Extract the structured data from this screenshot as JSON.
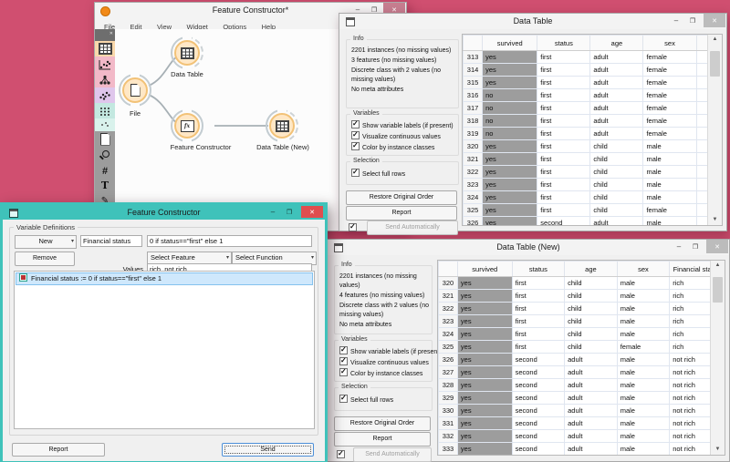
{
  "colors": {
    "desktop_bg": "#d04f70",
    "active_border_teal": "#3fc2ba",
    "node_fill": "#ffe7c6",
    "node_border": "#f2c277",
    "class_cell_gray": "#9d9d9d",
    "close_red": "#e04e4e"
  },
  "main_window": {
    "title": "Feature Constructor*",
    "menu": [
      "File",
      "Edit",
      "View",
      "Widget",
      "Options",
      "Help"
    ],
    "nodes": {
      "file": "File",
      "data_table": "Data Table",
      "feature_constructor": "Feature Constructor",
      "data_table_new": "Data Table (New)"
    }
  },
  "data_table_window": {
    "title": "Data Table",
    "info_heading": "Info",
    "info_lines": [
      "2201 instances (no missing values)",
      "3 features (no missing values)",
      "Discrete class with 2 values (no missing values)",
      "No meta attributes"
    ],
    "variables_heading": "Variables",
    "variable_options": [
      "Show variable labels (if present)",
      "Visualize continuous values",
      "Color by instance classes"
    ],
    "selection_heading": "Selection",
    "selection_options": [
      "Select full rows"
    ],
    "restore_button": "Restore Original Order",
    "report_button": "Report",
    "send_auto_button": "Send Automatically",
    "table": {
      "columns": [
        "survived",
        "status",
        "age",
        "sex"
      ],
      "rows": [
        [
          "313",
          "yes",
          "first",
          "adult",
          "female"
        ],
        [
          "314",
          "yes",
          "first",
          "adult",
          "female"
        ],
        [
          "315",
          "yes",
          "first",
          "adult",
          "female"
        ],
        [
          "316",
          "no",
          "first",
          "adult",
          "female"
        ],
        [
          "317",
          "no",
          "first",
          "adult",
          "female"
        ],
        [
          "318",
          "no",
          "first",
          "adult",
          "female"
        ],
        [
          "319",
          "no",
          "first",
          "adult",
          "female"
        ],
        [
          "320",
          "yes",
          "first",
          "child",
          "male"
        ],
        [
          "321",
          "yes",
          "first",
          "child",
          "male"
        ],
        [
          "322",
          "yes",
          "first",
          "child",
          "male"
        ],
        [
          "323",
          "yes",
          "first",
          "child",
          "male"
        ],
        [
          "324",
          "yes",
          "first",
          "child",
          "male"
        ],
        [
          "325",
          "yes",
          "first",
          "child",
          "female"
        ],
        [
          "326",
          "yes",
          "second",
          "adult",
          "male"
        ]
      ]
    }
  },
  "data_table_new_window": {
    "title": "Data Table (New)",
    "info_heading": "Info",
    "info_lines": [
      "2201 instances (no missing values)",
      "4 features (no missing values)",
      "Discrete class with 2 values (no missing values)",
      "No meta attributes"
    ],
    "variables_heading": "Variables",
    "variable_options": [
      "Show variable labels (if present)",
      "Visualize continuous values",
      "Color by instance classes"
    ],
    "selection_heading": "Selection",
    "selection_options": [
      "Select full rows"
    ],
    "restore_button": "Restore Original Order",
    "report_button": "Report",
    "send_auto_button": "Send Automatically",
    "table": {
      "columns": [
        "survived",
        "status",
        "age",
        "sex",
        "Financial status"
      ],
      "rows": [
        [
          "320",
          "yes",
          "first",
          "child",
          "male",
          "rich"
        ],
        [
          "321",
          "yes",
          "first",
          "child",
          "male",
          "rich"
        ],
        [
          "322",
          "yes",
          "first",
          "child",
          "male",
          "rich"
        ],
        [
          "323",
          "yes",
          "first",
          "child",
          "male",
          "rich"
        ],
        [
          "324",
          "yes",
          "first",
          "child",
          "male",
          "rich"
        ],
        [
          "325",
          "yes",
          "first",
          "child",
          "female",
          "rich"
        ],
        [
          "326",
          "yes",
          "second",
          "adult",
          "male",
          "not rich"
        ],
        [
          "327",
          "yes",
          "second",
          "adult",
          "male",
          "not rich"
        ],
        [
          "328",
          "yes",
          "second",
          "adult",
          "male",
          "not rich"
        ],
        [
          "329",
          "yes",
          "second",
          "adult",
          "male",
          "not rich"
        ],
        [
          "330",
          "yes",
          "second",
          "adult",
          "male",
          "not rich"
        ],
        [
          "331",
          "yes",
          "second",
          "adult",
          "male",
          "not rich"
        ],
        [
          "332",
          "yes",
          "second",
          "adult",
          "male",
          "not rich"
        ],
        [
          "333",
          "yes",
          "second",
          "adult",
          "male",
          "not rich"
        ]
      ]
    }
  },
  "feature_constructor": {
    "title": "Feature Constructor",
    "group_label": "Variable Definitions",
    "new_button": "New",
    "remove_button": "Remove",
    "name_field": "Financial status",
    "expression_field": "0 if status==\"first\" else 1",
    "select_feature": "Select Feature",
    "select_function": "Select Function",
    "values_label": "Values",
    "values_field": "rich, not rich",
    "list_item": "Financial status := 0 if status==\"first\" else 1",
    "report_button": "Report",
    "send_button": "Send"
  }
}
